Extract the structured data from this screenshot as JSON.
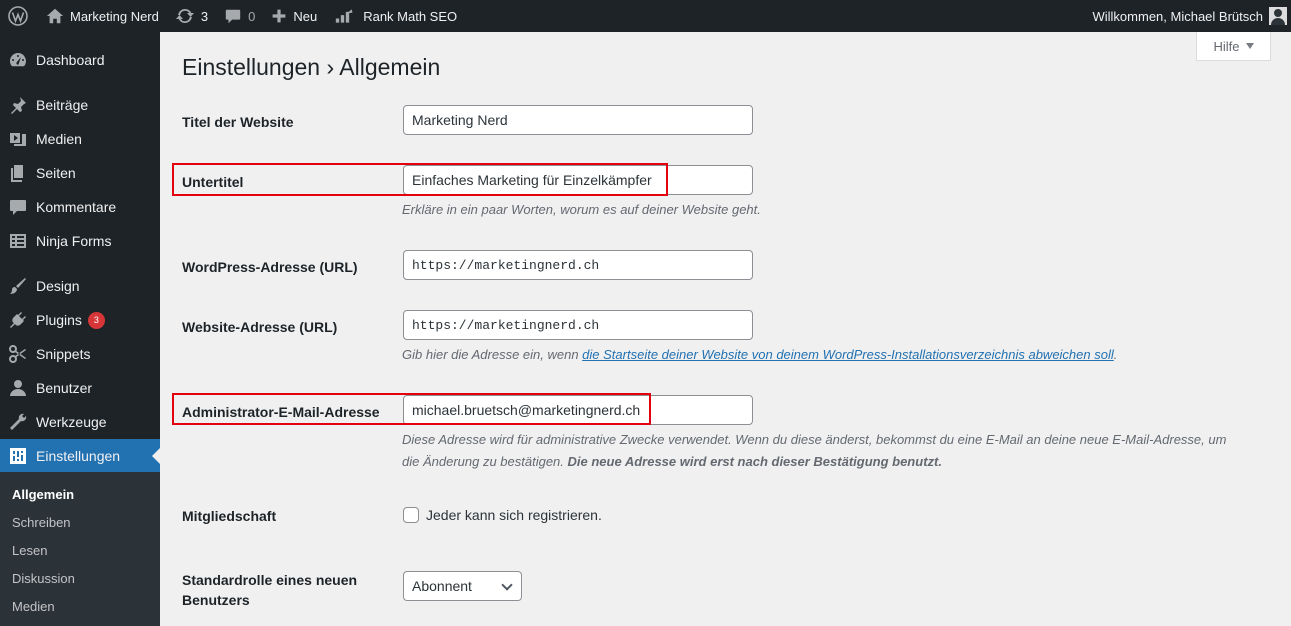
{
  "adminbar": {
    "site_name": "Marketing Nerd",
    "updates_count": "3",
    "comments_count": "0",
    "new_label": "Neu",
    "seo_label": "Rank Math SEO",
    "welcome": "Willkommen, Michael Brütsch"
  },
  "sidebar": {
    "items": [
      {
        "label": "Dashboard",
        "icon": "dashboard-icon"
      },
      {
        "label": "Beiträge",
        "icon": "pin-icon"
      },
      {
        "label": "Medien",
        "icon": "media-icon"
      },
      {
        "label": "Seiten",
        "icon": "pages-icon"
      },
      {
        "label": "Kommentare",
        "icon": "comment-icon"
      },
      {
        "label": "Ninja Forms",
        "icon": "forms-icon"
      },
      {
        "label": "Design",
        "icon": "brush-icon"
      },
      {
        "label": "Plugins",
        "icon": "plugin-icon",
        "badge": "3"
      },
      {
        "label": "Snippets",
        "icon": "scissors-icon"
      },
      {
        "label": "Benutzer",
        "icon": "user-icon"
      },
      {
        "label": "Werkzeuge",
        "icon": "wrench-icon"
      },
      {
        "label": "Einstellungen",
        "icon": "settings-icon"
      }
    ],
    "submenu": [
      "Allgemein",
      "Schreiben",
      "Lesen",
      "Diskussion",
      "Medien"
    ]
  },
  "help_label": "Hilfe",
  "page_title": "Einstellungen › Allgemein",
  "fields": {
    "site_title": {
      "label": "Titel der Website",
      "value": "Marketing Nerd"
    },
    "tagline": {
      "label": "Untertitel",
      "value": "Einfaches Marketing für Einzelkämpfer",
      "description": "Erkläre in ein paar Worten, worum es auf deiner Website geht."
    },
    "wp_url": {
      "label": "WordPress-Adresse (URL)",
      "value": "https://marketingnerd.ch"
    },
    "site_url": {
      "label": "Website-Adresse (URL)",
      "value": "https://marketingnerd.ch",
      "description_prefix": "Gib hier die Adresse ein, wenn ",
      "description_link": "die Startseite deiner Website von deinem WordPress-Installationsverzeichnis abweichen soll",
      "description_suffix": "."
    },
    "admin_email": {
      "label": "Administrator-E-Mail-Adresse",
      "value": "michael.bruetsch@marketingnerd.ch",
      "description_1": "Diese Adresse wird für administrative Zwecke verwendet. Wenn du diese änderst, bekommst du eine E-Mail an deine neue E-Mail-Adresse, um",
      "description_2": "die Änderung zu bestätigen. ",
      "description_bold": "Die neue Adresse wird erst nach dieser Bestätigung benutzt."
    },
    "membership": {
      "label": "Mitgliedschaft",
      "checkbox_label": "Jeder kann sich registrieren."
    },
    "default_role": {
      "label_1": "Standardrolle eines neuen",
      "label_2": "Benutzers",
      "value": "Abonnent"
    }
  },
  "highlight_color": "#e3000f"
}
